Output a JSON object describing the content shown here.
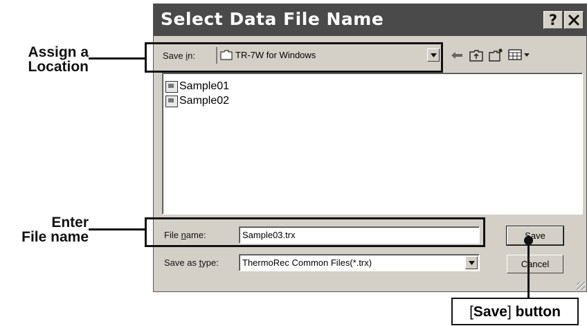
{
  "dialog": {
    "title": "Select Data File Name",
    "help_button": "?",
    "close_button": "X"
  },
  "save_in": {
    "label_prefix": "Save ",
    "label_underlined": "i",
    "label_suffix": "n:",
    "value": "TR-7W for Windows"
  },
  "toolbar": {
    "back_icon": "back-arrow-icon",
    "up_icon": "up-folder-icon",
    "new_folder_icon": "new-folder-icon",
    "view_icon": "view-menu-icon"
  },
  "files": [
    {
      "name": "Sample01"
    },
    {
      "name": "Sample02"
    }
  ],
  "file_name": {
    "label_prefix": "File ",
    "label_underlined": "n",
    "label_suffix": "ame:",
    "value": "Sample03.trx"
  },
  "save_as_type": {
    "label_prefix": "Save as ",
    "label_underlined": "t",
    "label_suffix": "ype:",
    "value": "ThermoRec Common Files(*.trx)"
  },
  "buttons": {
    "save_underlined": "S",
    "save_rest": "ave",
    "cancel": "Cancel"
  },
  "callouts": {
    "location_line1": "Assign a",
    "location_line2": "Location",
    "filename_line1": "Enter",
    "filename_line2": "File name",
    "save_bracket_open": "[",
    "save_word": "Save",
    "save_bracket_close": "]",
    "save_rest": " button"
  }
}
